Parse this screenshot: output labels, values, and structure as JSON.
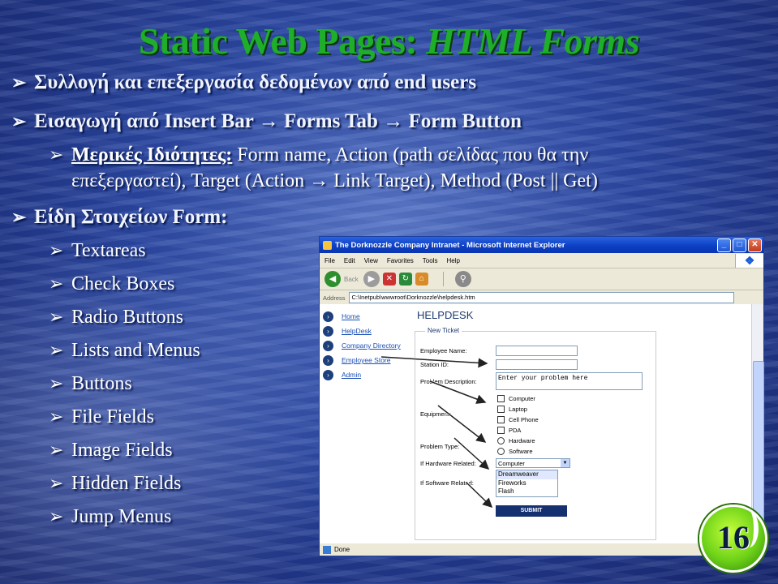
{
  "slide": {
    "title_main": "Static Web Pages:",
    "title_italic": "HTML Forms",
    "bullets": {
      "b1": "Συλλογή και επεξεργασία δεδομένων από end users",
      "b2_a": "Εισαγωγή από Insert Bar",
      "b2_arrow1": "→",
      "b2_b": "Forms Tab",
      "b2_arrow2": "→",
      "b2_c": "Form Button",
      "b3_label": "Μερικές Ιδιότητες:",
      "b3_line1": "Form name, Action (path σελίδας που θα την",
      "b3_line2_a": "επεξεργαστεί), Target (Action",
      "b3_arrow": "→",
      "b3_line2_b": "Link Target), Method (Post || Get)",
      "b4": "Είδη Στοιχείων Form:",
      "items": [
        "Textareas",
        "Check Boxes",
        "Radio Buttons",
        "Lists and Menus",
        "Buttons",
        "File Fields",
        "Image Fields",
        "Hidden Fields",
        "Jump Menus"
      ]
    },
    "page_number": "16"
  },
  "browser": {
    "title": "The Dorknozzle Company Intranet - Microsoft Internet Explorer",
    "menu": [
      "File",
      "Edit",
      "View",
      "Favorites",
      "Tools",
      "Help"
    ],
    "back_label": "Back",
    "address_label": "Address",
    "address_value": "C:\\Inetpub\\wwwroot\\Dorknozzle\\helpdesk.htm",
    "status": "Done",
    "nav": [
      "Home",
      "HelpDesk",
      "Company Directory",
      "Employee Store",
      "Admin"
    ],
    "heading": "HELPDESK",
    "fieldset_legend": "New Ticket",
    "labels": {
      "employee_name": "Employee Name:",
      "station_id": "Station ID:",
      "problem_description": "Problem Description:",
      "equipment": "Equipment:",
      "problem_type": "Problem Type:",
      "if_hardware": "If Hardware Related:",
      "if_software": "If Software Related:"
    },
    "textarea_value": "Enter your problem here",
    "equipment_options": [
      "Computer",
      "Laptop",
      "Cell Phone",
      "PDA"
    ],
    "problem_types": [
      "Hardware",
      "Software"
    ],
    "hardware_select": "Computer",
    "software_list": [
      "Dreamweaver",
      "Fireworks",
      "Flash"
    ],
    "submit_label": "SUBMIT"
  },
  "colors": {
    "title_green": "#1fae2a",
    "bullet_text": "#ffffff",
    "browser_titlebar": "#0b3ec1"
  }
}
